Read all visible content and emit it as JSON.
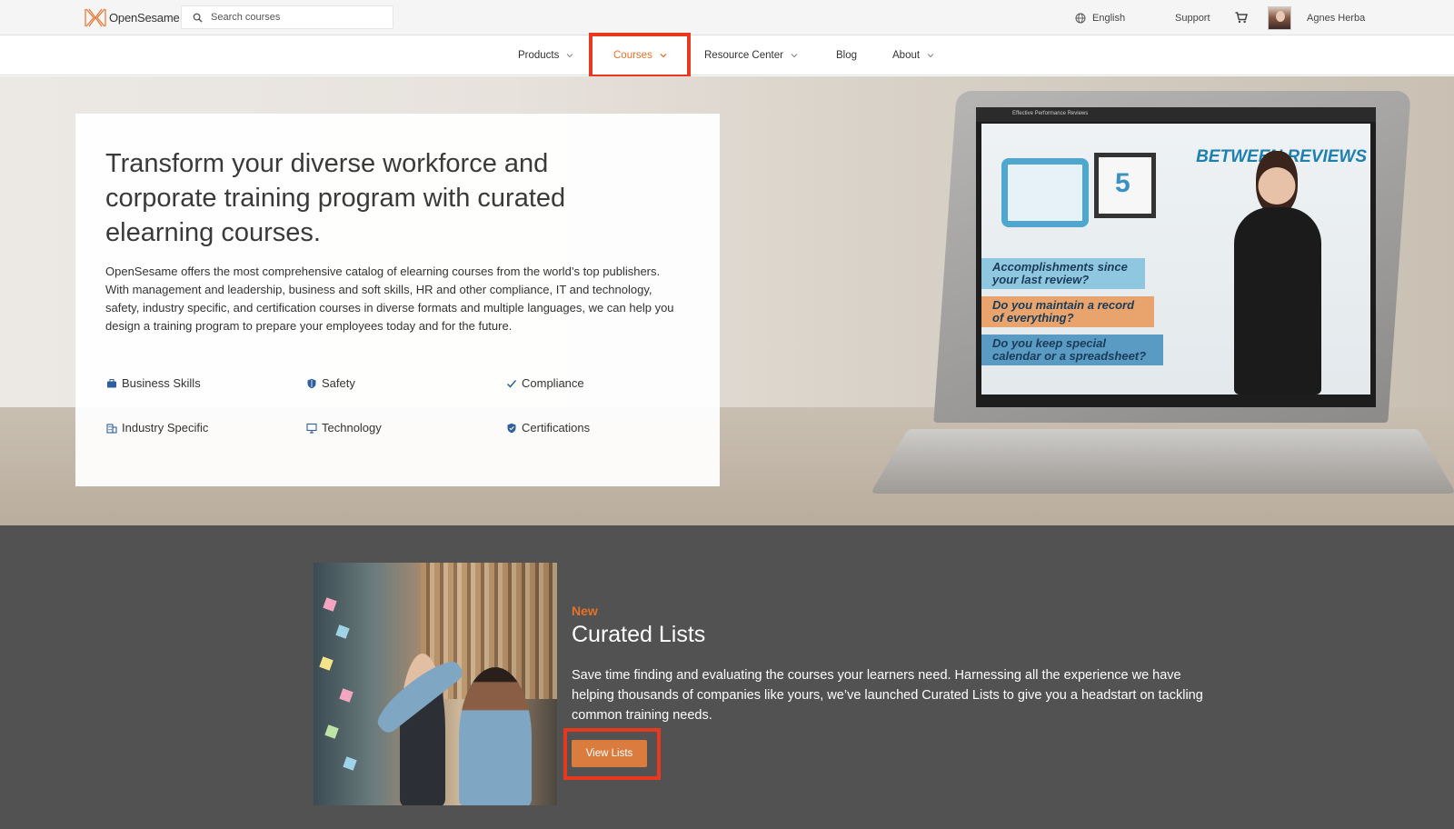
{
  "header": {
    "logo_text": "OpenSesame",
    "search_placeholder": "Search courses",
    "language": "English",
    "support": "Support",
    "user_name": "Agnes Herba"
  },
  "nav": {
    "items": [
      {
        "label": "Products",
        "has_dropdown": true
      },
      {
        "label": "Courses",
        "has_dropdown": true,
        "active": true
      },
      {
        "label": "Resource Center",
        "has_dropdown": true
      },
      {
        "label": "Blog",
        "has_dropdown": false
      },
      {
        "label": "About",
        "has_dropdown": true
      }
    ]
  },
  "hero": {
    "title": "Transform your diverse workforce and corporate training program with curated elearning courses.",
    "description": "OpenSesame offers the most comprehensive catalog of elearning courses from the world’s top publishers. With management and leadership, business and soft skills, HR and other compliance, IT and technology, safety, industry specific, and certification courses in diverse formats and multiple languages, we can help you design a training program to prepare your employees today and for the future.",
    "categories": [
      {
        "label": "Business Skills",
        "icon": "briefcase-icon"
      },
      {
        "label": "Safety",
        "icon": "shield-icon"
      },
      {
        "label": "Compliance",
        "icon": "checkmark-icon"
      },
      {
        "label": "Industry Specific",
        "icon": "building-icon"
      },
      {
        "label": "Technology",
        "icon": "monitor-icon"
      },
      {
        "label": "Certifications",
        "icon": "badge-icon"
      }
    ],
    "laptop_screen": {
      "bar_title": "Effective Performance Reviews",
      "heading": "BETWEEN REVIEWS",
      "calendar_number": "5",
      "ribbons": [
        "Accomplishments since your last review?",
        "Do you maintain a record of everything?",
        "Do you keep special calendar or a spreadsheet?"
      ]
    }
  },
  "curated": {
    "badge": "New",
    "title": "Curated Lists",
    "description": "Save time finding and evaluating the courses your learners need. Harnessing all the experience we have helping thousands of companies like yours, we’ve launched Curated Lists to give you a headstart on tackling common training needs.",
    "button_label": "View Lists"
  },
  "colors": {
    "accent": "#e5722b",
    "button": "#d97c3e",
    "highlight": "#e8391f",
    "dark_section": "#525252"
  }
}
